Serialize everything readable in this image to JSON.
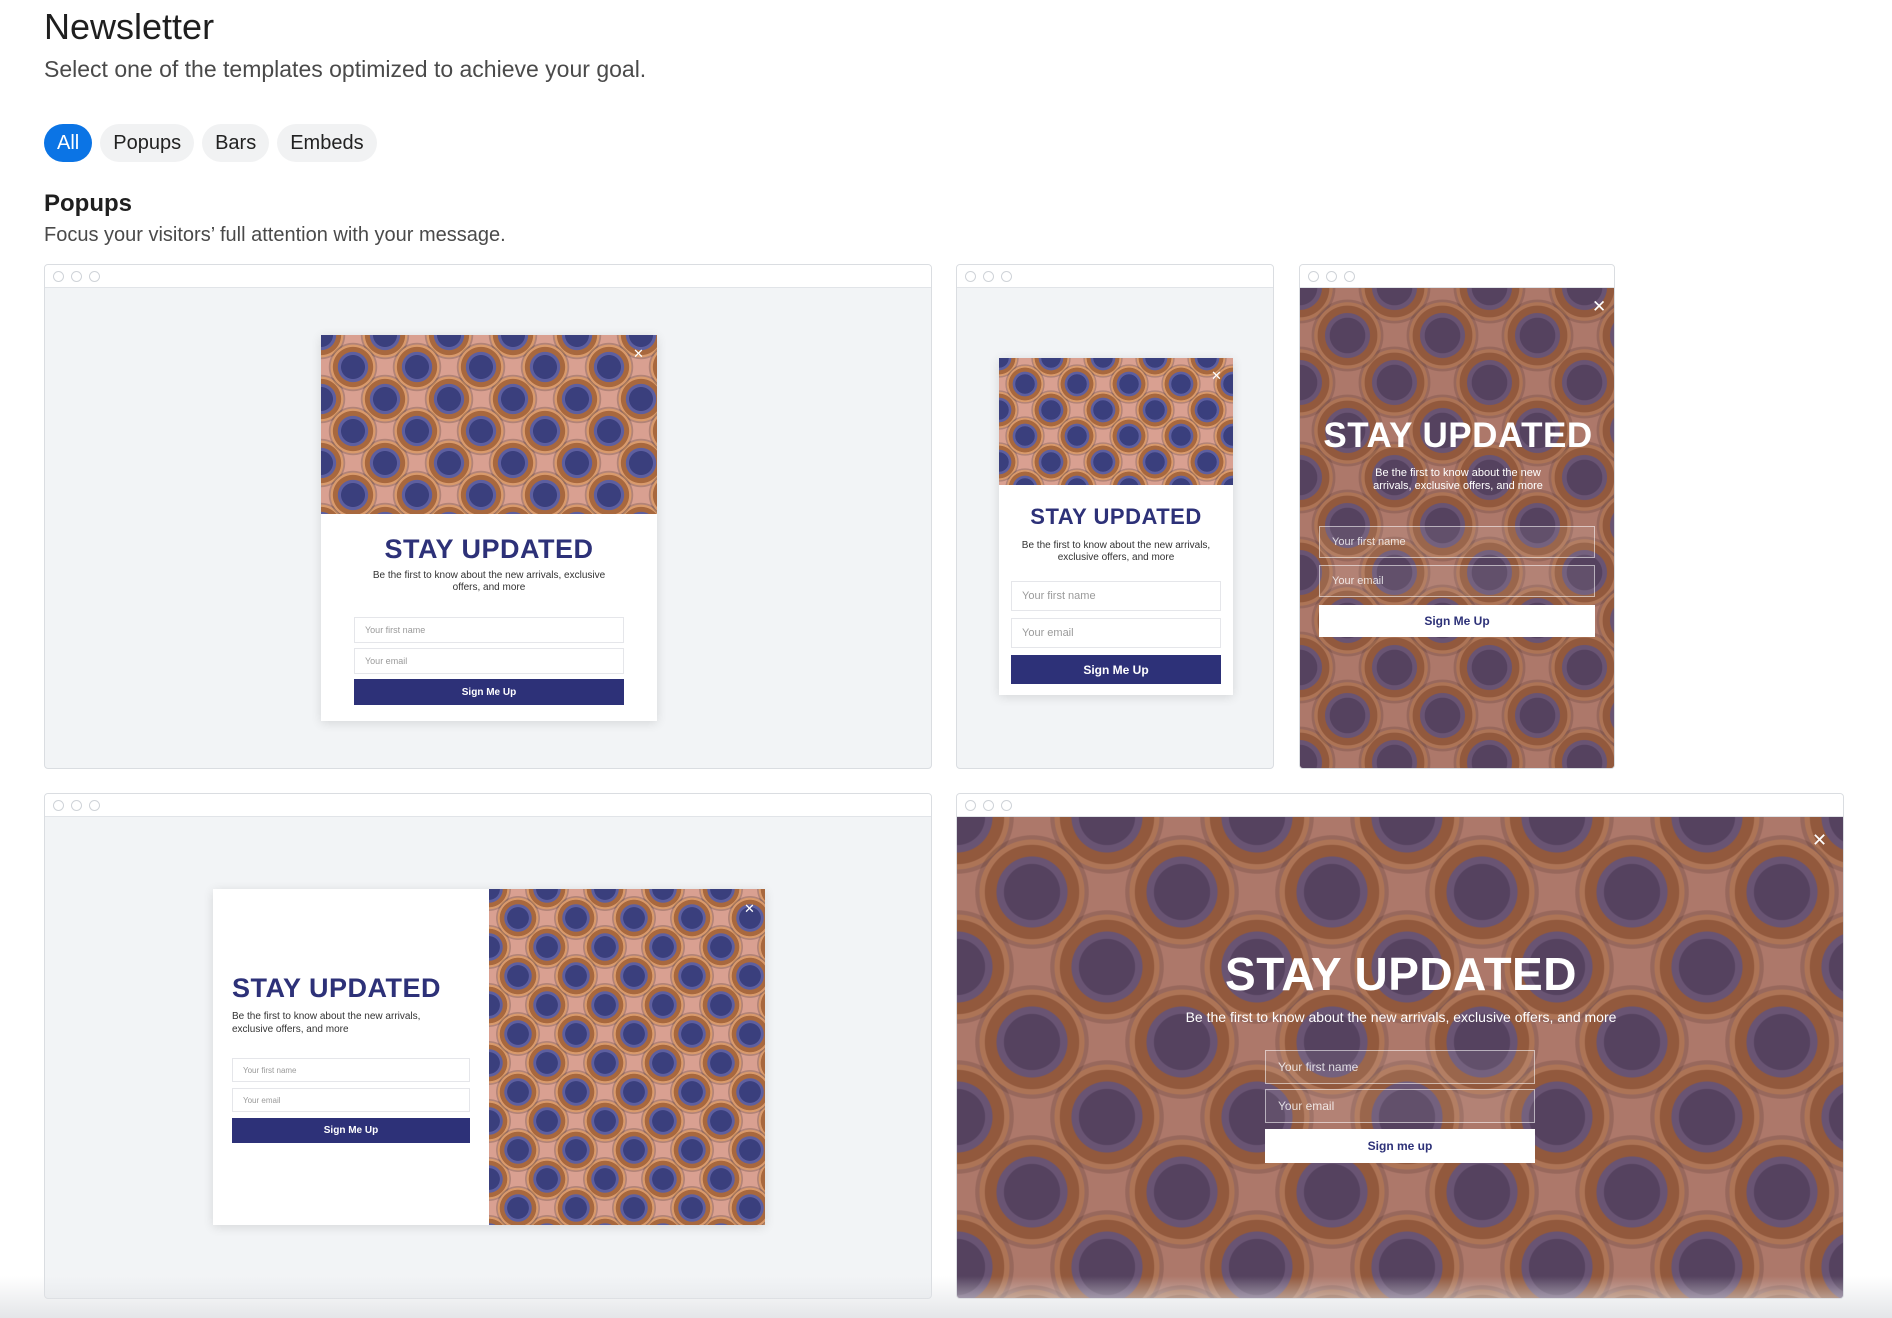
{
  "header": {
    "title": "Newsletter",
    "subtitle": "Select one of the templates optimized to achieve your goal."
  },
  "filters": [
    "All",
    "Popups",
    "Bars",
    "Embeds"
  ],
  "active_filter": "All",
  "section": {
    "title": "Popups",
    "description": "Focus your visitors’ full attention with your message."
  },
  "colors": {
    "accent": "#0b74e5",
    "navy": "#2d3178",
    "chip_bg": "#f1f2f3",
    "photo_pink": "#d9a091"
  },
  "templates": {
    "t1": {
      "headline": "STAY UPDATED",
      "text": "Be the first to know about the new arrivals, exclusive offers, and more",
      "first_name": "Your first name",
      "email": "Your email",
      "button": "Sign Me Up"
    },
    "t2": {
      "headline": "STAY UPDATED",
      "text": "Be the first to know about the new arrivals, exclusive offers, and more",
      "first_name": "Your first name",
      "email": "Your email",
      "button": "Sign Me Up"
    },
    "t3": {
      "headline": "STAY UPDATED",
      "text": "Be the first to know about the new arrivals, exclusive offers, and more",
      "first_name": "Your first name",
      "email": "Your email",
      "button": "Sign Me Up"
    },
    "t4": {
      "headline": "STAY UPDATED",
      "text": "Be the first to know about the new arrivals, exclusive offers, and more",
      "first_name": "Your first name",
      "email": "Your email",
      "button": "Sign Me Up"
    },
    "t5": {
      "headline": "STAY UPDATED",
      "text": "Be the first to know about the new arrivals, exclusive offers, and more",
      "first_name": "Your first name",
      "email": "Your email",
      "button": "Sign me up"
    }
  },
  "icons": {
    "close": "close-icon",
    "window_dots": "window-dot-icon"
  }
}
